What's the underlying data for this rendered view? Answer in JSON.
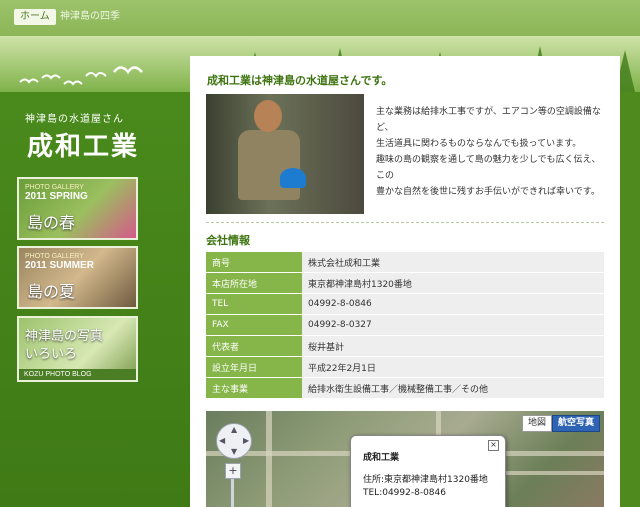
{
  "nav": {
    "home_label": "ホーム",
    "season_link": "神津島の四季"
  },
  "header": {
    "tagline": "神津島の水道屋さん",
    "brand": "成和工業"
  },
  "sidebar": {
    "banners": [
      {
        "small": "PHOTO GALLERY",
        "year": "2011 SPRING",
        "title": "島の春"
      },
      {
        "small": "PHOTO GALLERY",
        "year": "2011 SUMMER",
        "title": "島の夏"
      },
      {
        "title": "神津島の写真いろいろ",
        "footer": "KOZU PHOTO BLOG"
      }
    ]
  },
  "intro": {
    "title": "成和工業は神津島の水道屋さんです。",
    "lines": [
      "主な業務は給排水工事ですが、エアコン等の空調設備など、",
      "生活道具に関わるものならなんでも扱っています。",
      "趣味の島の観察を通して島の魅力を少しでも広く伝え、この",
      "豊かな自然を後世に残すお手伝いができれば幸いです。"
    ]
  },
  "company": {
    "title": "会社情報",
    "rows": [
      {
        "label": "商号",
        "value": "株式会社成和工業"
      },
      {
        "label": "本店所在地",
        "value": "東京都神津島村1320番地"
      },
      {
        "label": "TEL",
        "value": "04992-8-0846"
      },
      {
        "label": "FAX",
        "value": "04992-8-0327"
      },
      {
        "label": "代表者",
        "value": "桜井基計"
      },
      {
        "label": "設立年月日",
        "value": "平成22年2月1日"
      },
      {
        "label": "主な事業",
        "value": "給排水衛生設備工事／機械整備工事／その他"
      }
    ]
  },
  "map": {
    "tab_map": "地図",
    "tab_aerial": "航空写真",
    "zoom_in": "+",
    "balloon": {
      "title": "成和工業",
      "address": "住所:東京都神津島村1320番地",
      "tel": "TEL:04992-8-0846"
    }
  },
  "colors": {
    "accent_green": "#3d7410",
    "label_cell": "#86b549",
    "aerial_tab": "#2f64b4"
  }
}
